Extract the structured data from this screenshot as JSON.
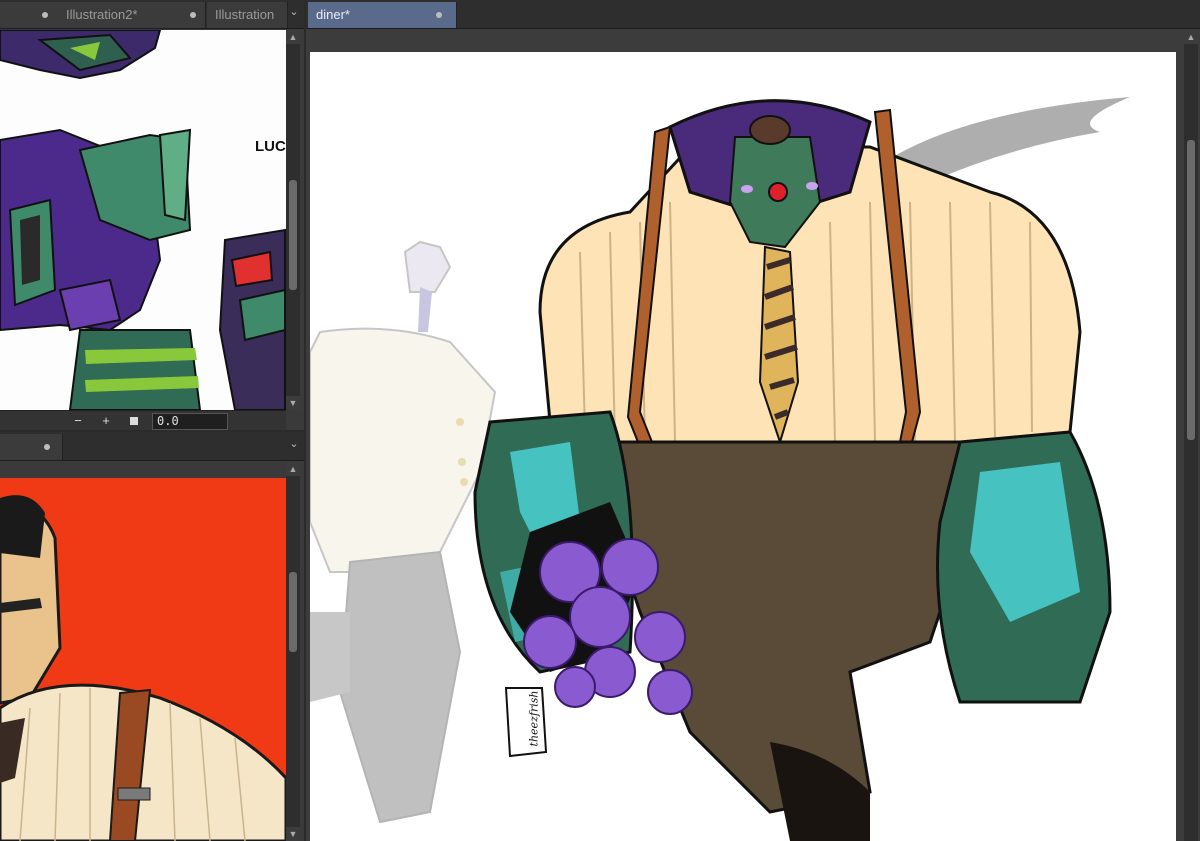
{
  "top_left_panel": {
    "tabs": [
      {
        "label": "Illustration2*"
      },
      {
        "label": "Illustration"
      }
    ],
    "zoom_minus": "−",
    "zoom_plus": "+",
    "rotation_value": "0.0",
    "artwork_text": "LUC"
  },
  "bottom_left_panel": {
    "tab_label": ""
  },
  "main_panel": {
    "tab": {
      "label": "diner*"
    },
    "signature": "theezfrish"
  },
  "icons": {
    "scroll_up": "scroll-up-icon",
    "scroll_down": "scroll-down-icon",
    "tab_close": "close-dot-icon",
    "menu": "chevron-down-icon"
  },
  "colors": {
    "active_tab": "#5a6a8a",
    "panel_bg": "#3a3a3a",
    "canvas_bg": "#ffffff",
    "reference_red": "#ef3a15"
  }
}
